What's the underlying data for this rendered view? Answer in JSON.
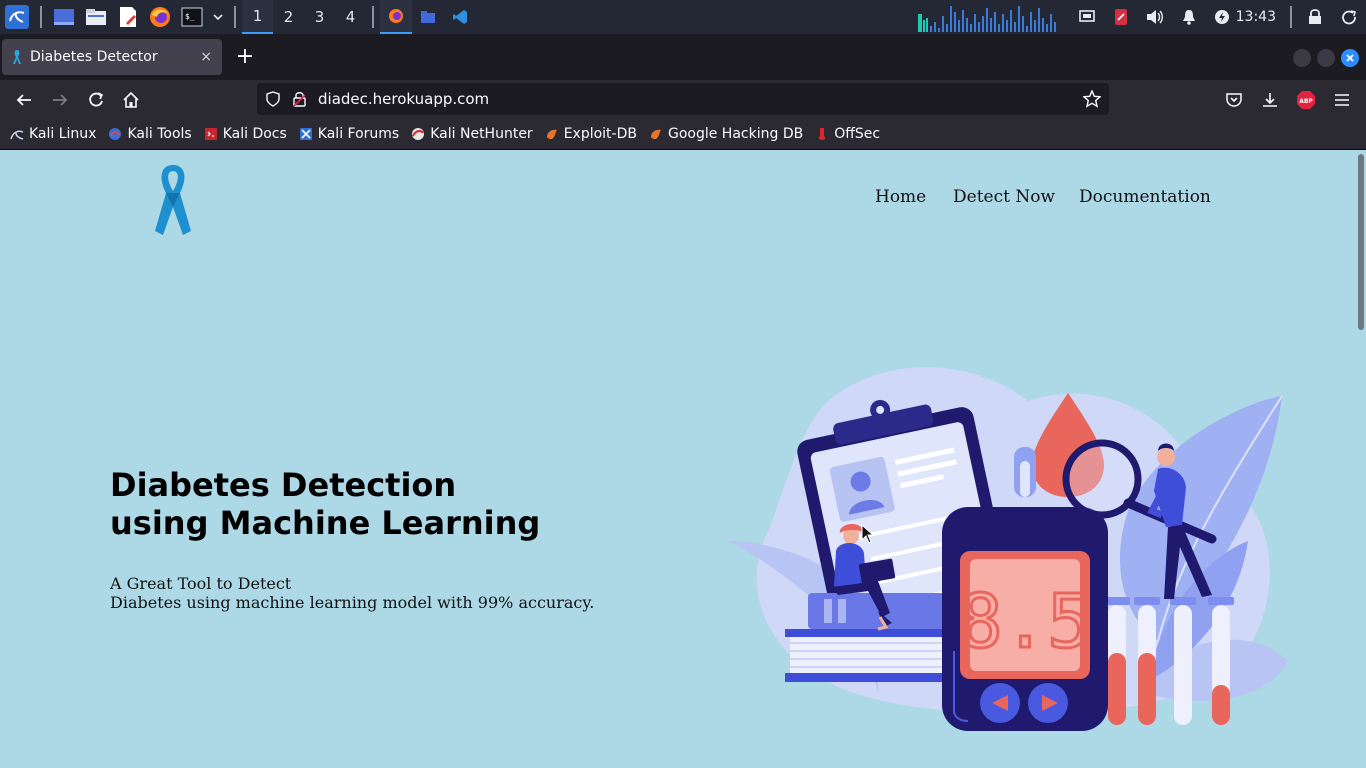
{
  "taskbar": {
    "workspaces": [
      "1",
      "2",
      "3",
      "4"
    ],
    "active_workspace": "1",
    "clock": "13:43"
  },
  "browser": {
    "tab_title": "Diabetes Detector",
    "tab_close": "×",
    "new_tab": "+",
    "url": "diadec.herokuapp.com",
    "bookmarks": [
      {
        "label": "Kali Linux",
        "icon": "kali-dragon-icon"
      },
      {
        "label": "Kali Tools",
        "icon": "kali-tools-icon"
      },
      {
        "label": "Kali Docs",
        "icon": "kali-docs-icon"
      },
      {
        "label": "Kali Forums",
        "icon": "kali-forums-icon"
      },
      {
        "label": "Kali NetHunter",
        "icon": "nethunter-icon"
      },
      {
        "label": "Exploit-DB",
        "icon": "exploit-db-icon"
      },
      {
        "label": "Google Hacking DB",
        "icon": "ghdb-icon"
      },
      {
        "label": "OffSec",
        "icon": "offsec-icon"
      }
    ]
  },
  "site": {
    "nav": [
      {
        "label": "Home"
      },
      {
        "label": "Detect Now"
      },
      {
        "label": "Documentation"
      }
    ],
    "hero": {
      "title_line1": "Diabetes Detection",
      "title_line2": "using Machine Learning",
      "sub_line1": "A Great Tool to Detect",
      "sub_line2": "Diabetes using machine learning model with 99% accuracy."
    },
    "illustration": {
      "meter_reading": "8.5"
    },
    "colors": {
      "page_bg": "#add8e6",
      "ribbon": "#1e90d0",
      "illustration_navy": "#1f1a6e",
      "illustration_periwinkle": "#7d8ef0",
      "illustration_red": "#e8665c"
    }
  }
}
